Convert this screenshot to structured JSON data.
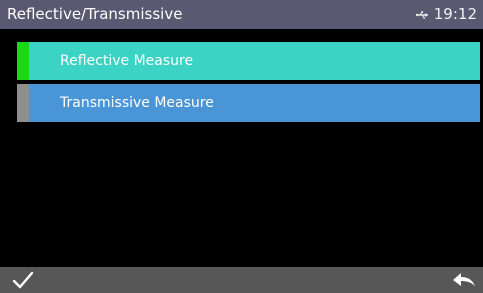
{
  "header": {
    "title": "Reflective/Transmissive",
    "usb_icon": "usb-icon",
    "time": "19:12"
  },
  "menu": {
    "items": [
      {
        "label": "Reflective Measure",
        "selected": true,
        "background_color": "#3ad3c4",
        "indicator_color": "#19d719"
      },
      {
        "label": "Transmissive Measure",
        "selected": false,
        "background_color": "#4a95d6",
        "indicator_color": "#8e8e8e"
      }
    ]
  },
  "footer": {
    "confirm_icon": "checkmark-icon",
    "back_icon": "back-arrow-icon"
  },
  "colors": {
    "header_bg": "#5b5872",
    "content_bg": "#000000",
    "footer_bg": "#575757"
  }
}
